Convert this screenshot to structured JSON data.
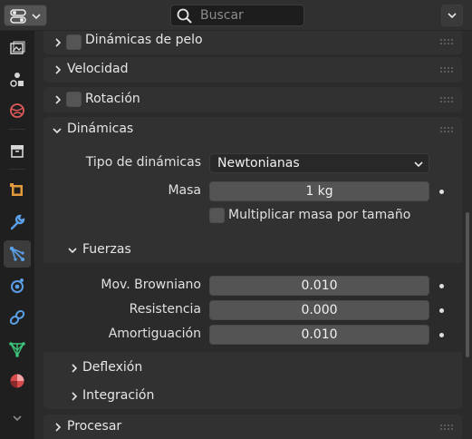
{
  "header": {
    "search_placeholder": "Buscar"
  },
  "tabs": [
    {
      "name": "render-tab",
      "icon": "render-icon"
    },
    {
      "name": "output-tab",
      "icon": "output-icon"
    },
    {
      "name": "view-layer-tab",
      "icon": "view-layer-icon"
    },
    {
      "name": "scene-tab",
      "icon": "scene-icon"
    },
    {
      "name": "world-tab",
      "icon": "world-icon"
    },
    {
      "name": "collection-tab",
      "icon": "collection-icon"
    },
    {
      "name": "object-tab",
      "icon": "object-icon"
    },
    {
      "name": "modifiers-tab",
      "icon": "wrench-icon"
    },
    {
      "name": "particles-tab",
      "icon": "particles-icon",
      "active": true
    },
    {
      "name": "physics-tab",
      "icon": "physics-icon"
    },
    {
      "name": "constraints-tab",
      "icon": "constraints-icon"
    },
    {
      "name": "data-tab",
      "icon": "mesh-data-icon"
    },
    {
      "name": "material-tab",
      "icon": "material-icon"
    },
    {
      "name": "texture-tab",
      "icon": "chevron-down-icon"
    }
  ],
  "panels": {
    "hair_dynamics": {
      "label": "Dinámicas de pelo"
    },
    "velocity": {
      "label": "Velocidad"
    },
    "rotation": {
      "label": "Rotación"
    },
    "dynamics": {
      "label": "Dinámicas",
      "type_label": "Tipo de dinámicas",
      "type_value": "Newtonianas",
      "mass_label": "Masa",
      "mass_value": "1 kg",
      "multiply_mass_label": "Multiplicar masa por tamaño",
      "forces": {
        "label": "Fuerzas",
        "brownian_label": "Mov. Browniano",
        "brownian_value": "0.010",
        "drag_label": "Resistencia",
        "drag_value": "0.000",
        "damp_label": "Amortiguación",
        "damp_value": "0.010"
      },
      "deflection": {
        "label": "Deflexión"
      },
      "integration": {
        "label": "Integración"
      }
    },
    "render": {
      "label": "Procesar"
    }
  }
}
